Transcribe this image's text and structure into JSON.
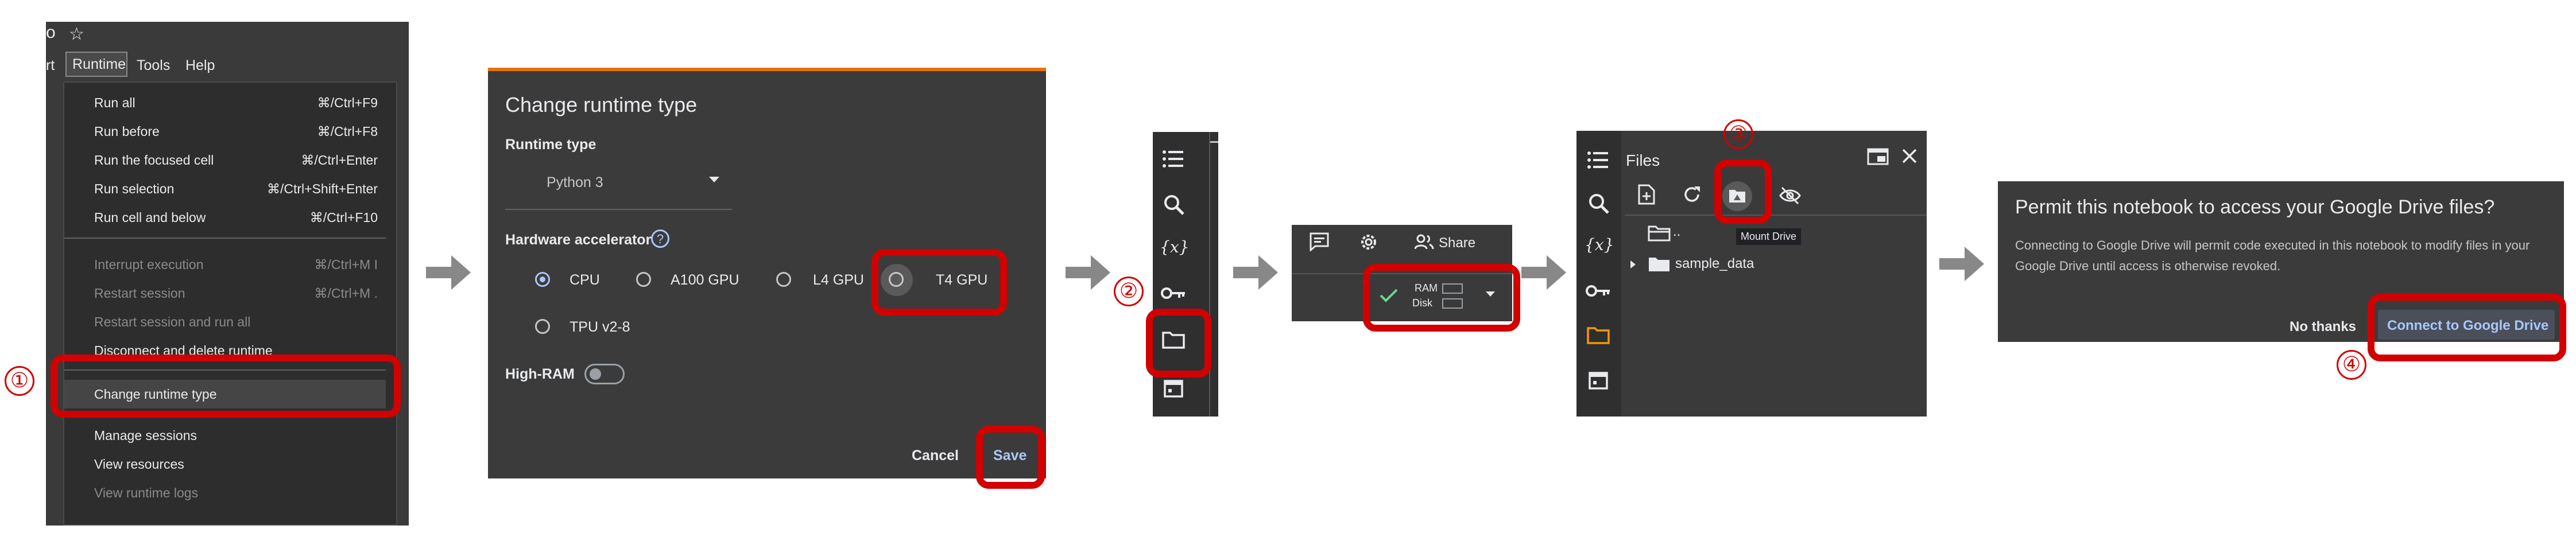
{
  "panel1": {
    "top_glyph": "o",
    "star": "☆",
    "menubar": [
      "rt",
      "Runtime",
      "Tools",
      "Help"
    ],
    "items": [
      {
        "label": "Run all",
        "shortcut": "⌘/Ctrl+F9",
        "enabled": true
      },
      {
        "label": "Run before",
        "shortcut": "⌘/Ctrl+F8",
        "enabled": true
      },
      {
        "label": "Run the focused cell",
        "shortcut": "⌘/Ctrl+Enter",
        "enabled": true
      },
      {
        "label": "Run selection",
        "shortcut": "⌘/Ctrl+Shift+Enter",
        "enabled": true
      },
      {
        "label": "Run cell and below",
        "shortcut": "⌘/Ctrl+F10",
        "enabled": true
      },
      {
        "label": "Interrupt execution",
        "shortcut": "⌘/Ctrl+M I",
        "enabled": false
      },
      {
        "label": "Restart session",
        "shortcut": "⌘/Ctrl+M .",
        "enabled": false
      },
      {
        "label": "Restart session and run all",
        "shortcut": "",
        "enabled": false
      },
      {
        "label": "Disconnect and delete runtime",
        "shortcut": "",
        "enabled": true
      },
      {
        "label": "Change runtime type",
        "shortcut": "",
        "enabled": true
      },
      {
        "label": "Manage sessions",
        "shortcut": "",
        "enabled": true
      },
      {
        "label": "View resources",
        "shortcut": "",
        "enabled": true
      },
      {
        "label": "View runtime logs",
        "shortcut": "",
        "enabled": false
      }
    ]
  },
  "panel2": {
    "title": "Change runtime type",
    "runtime_type_label": "Runtime type",
    "runtime_type_value": "Python 3",
    "hardware_label": "Hardware accelerator",
    "help": "?",
    "options": [
      {
        "label": "CPU",
        "selected": true
      },
      {
        "label": "A100 GPU",
        "selected": false
      },
      {
        "label": "L4 GPU",
        "selected": false
      },
      {
        "label": "T4 GPU",
        "selected": false
      },
      {
        "label": "TPU v2-8",
        "selected": false
      }
    ],
    "high_ram_label": "High-RAM",
    "cancel": "Cancel",
    "save": "Save"
  },
  "panel4": {
    "share": "Share",
    "ram": "RAM",
    "disk": "Disk"
  },
  "panel5": {
    "title": "Files",
    "parent": "..",
    "folder": "sample_data",
    "tooltip": "Mount Drive"
  },
  "panel6": {
    "title": "Permit this notebook to access your Google Drive files?",
    "body": "Connecting to Google Drive will permit code executed in this notebook to modify files in your Google Drive until access is otherwise revoked.",
    "no_thanks": "No thanks",
    "connect": "Connect to Google Drive"
  },
  "steps": [
    "①",
    "②",
    "③",
    "④"
  ],
  "colors": {
    "highlight": "#d20000",
    "accent": "#a8c7fa",
    "panel": "#3c3c3c",
    "folder_active": "#f29900"
  }
}
